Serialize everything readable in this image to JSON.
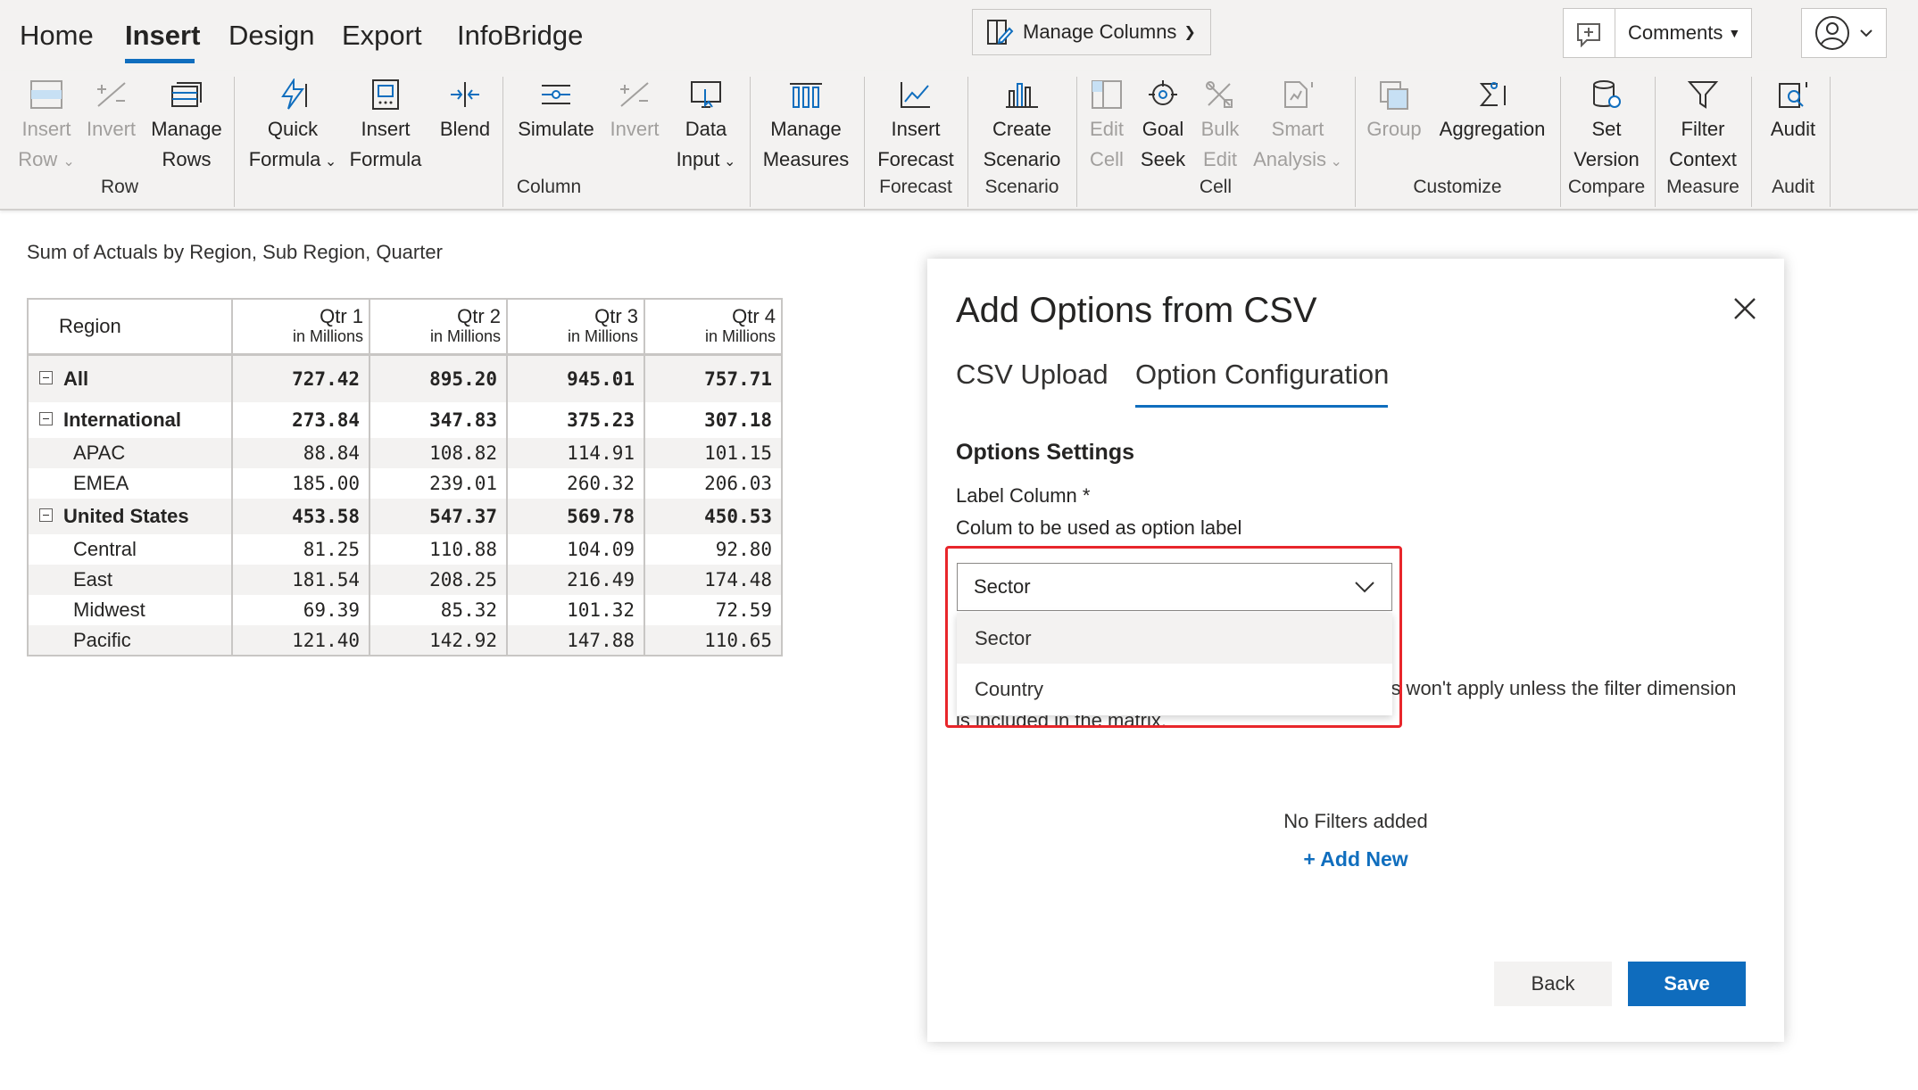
{
  "menu": {
    "tabs": [
      "Home",
      "Insert",
      "Design",
      "Export",
      "InfoBridge"
    ],
    "active": "Insert",
    "manage_columns": "Manage Columns",
    "comments": "Comments"
  },
  "ribbon": {
    "buttons": {
      "insert_row": [
        "Insert",
        "Row"
      ],
      "invert_row": [
        "Invert",
        ""
      ],
      "manage_rows": [
        "Manage",
        "Rows"
      ],
      "quick_formula": [
        "Quick",
        "Formula"
      ],
      "insert_formula": [
        "Insert",
        "Formula"
      ],
      "blend": [
        "Blend",
        ""
      ],
      "simulate": [
        "Simulate",
        ""
      ],
      "invert_col": [
        "Invert",
        ""
      ],
      "data_input": [
        "Data",
        "Input"
      ],
      "manage_measures": [
        "Manage",
        "Measures"
      ],
      "insert_forecast": [
        "Insert",
        "Forecast"
      ],
      "create_scenario": [
        "Create",
        "Scenario"
      ],
      "edit_cell": [
        "Edit",
        "Cell"
      ],
      "goal_seek": [
        "Goal",
        "Seek"
      ],
      "bulk_edit": [
        "Bulk",
        "Edit"
      ],
      "smart_analysis": [
        "Smart",
        "Analysis"
      ],
      "group": [
        "Group",
        ""
      ],
      "aggregation": [
        "Aggregation",
        ""
      ],
      "set_version": [
        "Set",
        "Version"
      ],
      "filter_context": [
        "Filter",
        "Context"
      ],
      "audit": [
        "Audit",
        ""
      ]
    },
    "groups": {
      "row": "Row",
      "column": "Column",
      "forecast": "Forecast",
      "scenario": "Scenario",
      "cell": "Cell",
      "customize": "Customize",
      "compare": "Compare",
      "measure": "Measure",
      "audit": "Audit"
    }
  },
  "matrix": {
    "title": "Sum of Actuals by Region, Sub Region, Quarter",
    "header_region": "Region",
    "quarters": [
      "Qtr 1",
      "Qtr 2",
      "Qtr 3",
      "Qtr 4"
    ],
    "unit": "in Millions",
    "rows": [
      {
        "label": "All",
        "values": [
          "727.42",
          "895.20",
          "945.01",
          "757.71"
        ]
      },
      {
        "label": "International",
        "values": [
          "273.84",
          "347.83",
          "375.23",
          "307.18"
        ]
      },
      {
        "label": "APAC",
        "values": [
          "88.84",
          "108.82",
          "114.91",
          "101.15"
        ]
      },
      {
        "label": "EMEA",
        "values": [
          "185.00",
          "239.01",
          "260.32",
          "206.03"
        ]
      },
      {
        "label": "United States",
        "values": [
          "453.58",
          "547.37",
          "569.78",
          "450.53"
        ]
      },
      {
        "label": "Central",
        "values": [
          "81.25",
          "110.88",
          "104.09",
          "92.80"
        ]
      },
      {
        "label": "East",
        "values": [
          "181.54",
          "208.25",
          "216.49",
          "174.48"
        ]
      },
      {
        "label": "Midwest",
        "values": [
          "69.39",
          "85.32",
          "101.32",
          "72.59"
        ]
      },
      {
        "label": "Pacific",
        "values": [
          "121.40",
          "142.92",
          "147.88",
          "110.65"
        ]
      }
    ]
  },
  "dialog": {
    "title": "Add Options from CSV",
    "tabs": [
      "CSV Upload",
      "Option Configuration"
    ],
    "active_tab": "Option Configuration",
    "section_title": "Options Settings",
    "label_column": "Label Column *",
    "label_help": "Colum to be used as option label",
    "select_value": "Sector",
    "options": [
      "Sector",
      "Country"
    ],
    "info_text": "ilters won't apply unless the filter dimension",
    "info_text_2": "is included in the matrix.",
    "no_filters": "No Filters added",
    "add_new": "+ Add New",
    "back": "Back",
    "save": "Save"
  },
  "colors": {
    "accent": "#106ebe",
    "highlight": "#e8262b",
    "ribbon_bg": "#f3f2f1"
  }
}
